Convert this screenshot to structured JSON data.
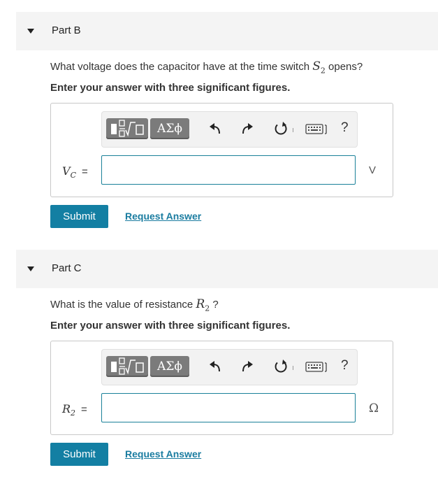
{
  "partB": {
    "title": "Part B",
    "question_prefix": "What voltage does the capacitor have at the time switch ",
    "question_var": "S",
    "question_var_sub": "2",
    "question_suffix": " opens?",
    "instruction": "Enter your answer with three significant figures.",
    "var_label": "V",
    "var_label_sub": "C",
    "equals": "=",
    "input_value": "",
    "unit": "V",
    "submit_label": "Submit",
    "request_label": "Request Answer"
  },
  "partC": {
    "title": "Part C",
    "question_prefix": "What is the value of resistance ",
    "question_var": "R",
    "question_var_sub": "2",
    "question_suffix": " ?",
    "instruction": "Enter your answer with three significant figures.",
    "var_label": "R",
    "var_label_sub": "2",
    "equals": "=",
    "input_value": "",
    "unit": "Ω",
    "submit_label": "Submit",
    "request_label": "Request Answer"
  },
  "toolbar": {
    "greek_label": "ΑΣϕ",
    "help_label": "?",
    "icons": [
      "math-template-icon",
      "greek-letters-icon",
      "undo-icon",
      "redo-icon",
      "reset-icon",
      "keyboard-icon",
      "help-icon"
    ]
  },
  "colors": {
    "header_bg": "#f4f4f4",
    "button_bg": "#137fa3",
    "link": "#1a7ca0",
    "toolbar_btn": "#7b7b7b"
  }
}
